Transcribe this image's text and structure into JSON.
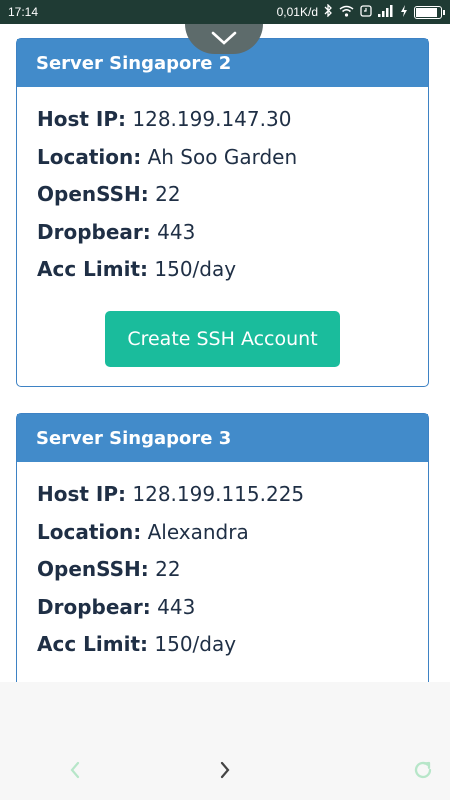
{
  "status_bar": {
    "time": "17:14",
    "speed": "0,01K/d",
    "icons": [
      "bluetooth-icon",
      "wifi-icon",
      "alarm-icon",
      "signal-icon",
      "charging-icon",
      "battery-icon"
    ],
    "battery_level": 0.9
  },
  "servers": [
    {
      "name": "Server Singapore 2",
      "fields": [
        {
          "key": "Host IP:",
          "value": "128.199.147.30"
        },
        {
          "key": "Location:",
          "value": "Ah Soo Garden"
        },
        {
          "key": "OpenSSH:",
          "value": "22"
        },
        {
          "key": "Dropbear:",
          "value": "443"
        },
        {
          "key": "Acc Limit:",
          "value": "150/day"
        }
      ],
      "button_label": "Create SSH Account"
    },
    {
      "name": "Server Singapore 3",
      "fields": [
        {
          "key": "Host IP:",
          "value": "128.199.115.225"
        },
        {
          "key": "Location:",
          "value": "Alexandra"
        },
        {
          "key": "OpenSSH:",
          "value": "22"
        },
        {
          "key": "Dropbear:",
          "value": "443"
        },
        {
          "key": "Acc Limit:",
          "value": "150/day"
        }
      ]
    }
  ],
  "browser_nav": {
    "icons": [
      "back-chevron-icon",
      "forward-chevron-icon",
      "refresh-icon"
    ]
  },
  "colors": {
    "header": "#428bca",
    "button": "#1abc9c",
    "text": "#1f2f45",
    "status_bar": "#1f3b34"
  }
}
